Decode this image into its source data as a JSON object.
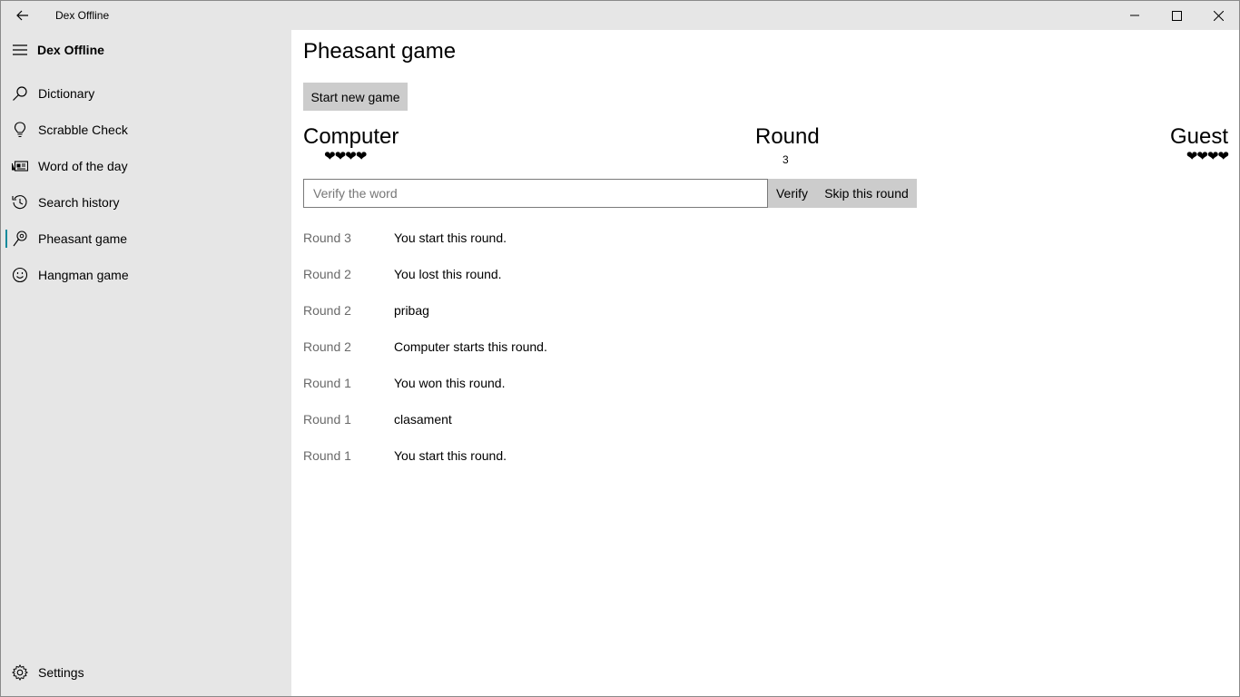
{
  "window": {
    "title": "Dex Offline"
  },
  "sidebar": {
    "app_name": "Dex Offline",
    "items": [
      {
        "label": "Dictionary",
        "icon": "search-icon"
      },
      {
        "label": "Scrabble Check",
        "icon": "lightbulb-icon"
      },
      {
        "label": "Word of the day",
        "icon": "news-icon"
      },
      {
        "label": "Search history",
        "icon": "history-icon"
      },
      {
        "label": "Pheasant game",
        "icon": "map-pin-icon",
        "selected": true
      },
      {
        "label": "Hangman game",
        "icon": "smiley-icon"
      }
    ],
    "settings_label": "Settings",
    "accent": "#0f8a9c"
  },
  "game": {
    "title": "Pheasant game",
    "start_label": "Start new game",
    "computer_label": "Computer",
    "computer_hearts": "❤❤❤❤",
    "round_label": "Round",
    "round_number": "3",
    "guest_label": "Guest",
    "guest_hearts": "❤❤❤❤",
    "input_placeholder": "Verify the word",
    "input_value": "",
    "verify_label": "Verify",
    "skip_label": "Skip this round"
  },
  "log": [
    {
      "round": "Round 3",
      "message": "You start this round."
    },
    {
      "round": "Round 2",
      "message": "You lost this round."
    },
    {
      "round": "Round 2",
      "message": "pribag"
    },
    {
      "round": "Round 2",
      "message": "Computer starts this round."
    },
    {
      "round": "Round 1",
      "message": "You won this round."
    },
    {
      "round": "Round 1",
      "message": "clasament"
    },
    {
      "round": "Round 1",
      "message": "You start this round."
    }
  ]
}
